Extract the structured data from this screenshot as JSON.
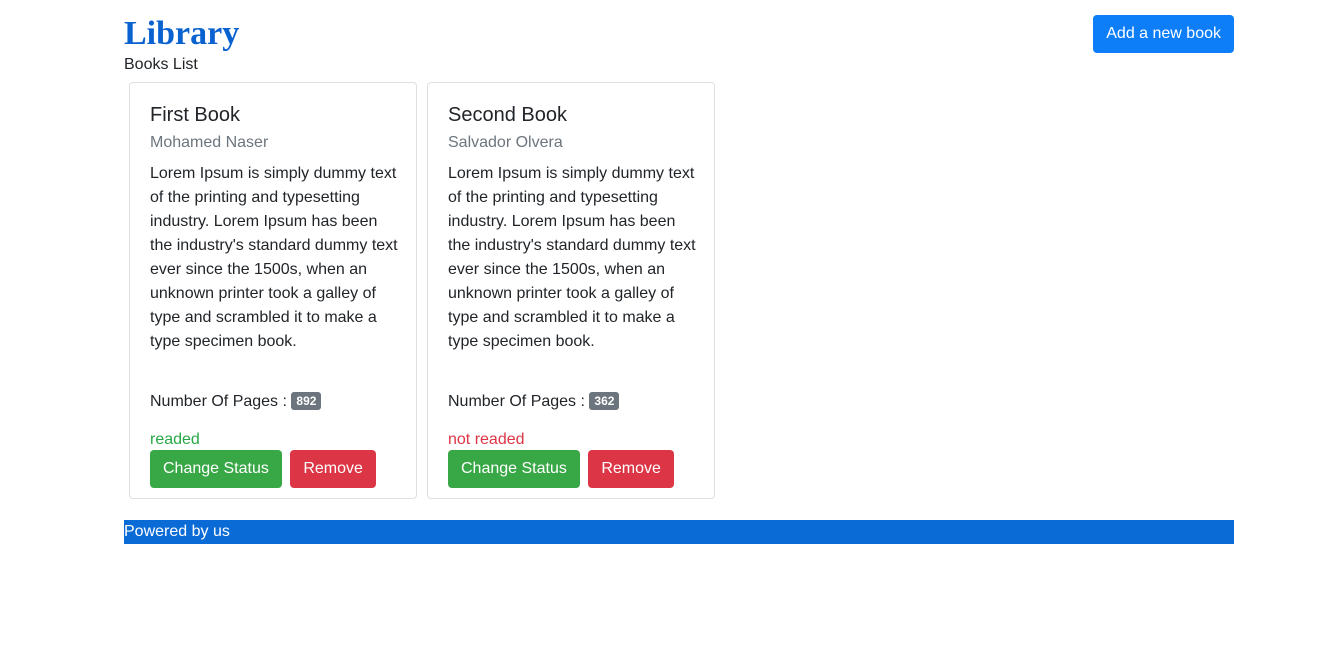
{
  "header": {
    "title": "Library",
    "subtitle": "Books List",
    "add_button_label": "Add a new book"
  },
  "books": [
    {
      "title": "First Book",
      "author": "Mohamed Naser",
      "description": "Lorem Ipsum is simply dummy text of the printing and typesetting industry. Lorem Ipsum has been the industry's standard dummy text ever since the 1500s, when an unknown printer took a galley of type and scrambled it to make a type specimen book.",
      "pages_label": "Number Of Pages :",
      "pages": "892",
      "status": "readed",
      "change_status_label": "Change Status",
      "remove_label": "Remove"
    },
    {
      "title": "Second Book",
      "author": "Salvador Olvera",
      "description": "Lorem Ipsum is simply dummy text of the printing and typesetting industry. Lorem Ipsum has been the industry's standard dummy text ever since the 1500s, when an unknown printer took a galley of type and scrambled it to make a type specimen book.",
      "pages_label": "Number Of Pages :",
      "pages": "362",
      "status": "not readed",
      "change_status_label": "Change Status",
      "remove_label": "Remove"
    }
  ],
  "footer": {
    "text": "Powered by us"
  },
  "colors": {
    "title": "#0a62d0",
    "primary": "#0d7ef8",
    "success": "#28a745",
    "danger": "#dc3545",
    "footer_bg": "#0a6bd6"
  }
}
